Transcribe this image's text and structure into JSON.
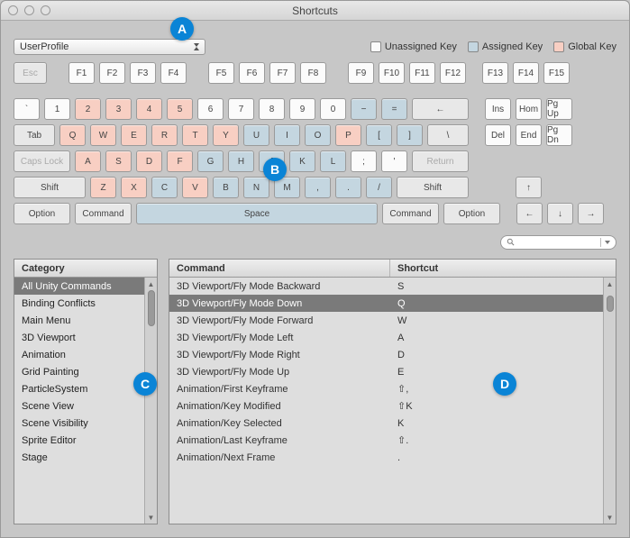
{
  "window": {
    "title": "Shortcuts"
  },
  "profile": {
    "selected": "UserProfile"
  },
  "legend": {
    "unassigned": "Unassigned Key",
    "assigned": "Assigned Key",
    "global": "Global Key"
  },
  "callouts": {
    "a": "A",
    "b": "B",
    "c": "C",
    "d": "D"
  },
  "keys": {
    "esc": "Esc",
    "f1": "F1",
    "f2": "F2",
    "f3": "F3",
    "f4": "F4",
    "f5": "F5",
    "f6": "F6",
    "f7": "F7",
    "f8": "F8",
    "f9": "F9",
    "f10": "F10",
    "f11": "F11",
    "f12": "F12",
    "f13": "F13",
    "f14": "F14",
    "f15": "F15",
    "backtick": "`",
    "k1": "1",
    "k2": "2",
    "k3": "3",
    "k4": "4",
    "k5": "5",
    "k6": "6",
    "k7": "7",
    "k8": "8",
    "k9": "9",
    "k0": "0",
    "minus": "−",
    "equals": "=",
    "back": "←",
    "ins": "Ins",
    "home": "Hom",
    "pgup": "Pg Up",
    "tab": "Tab",
    "q": "Q",
    "w": "W",
    "e": "E",
    "r": "R",
    "t": "T",
    "y": "Y",
    "u": "U",
    "i": "I",
    "o": "O",
    "p": "P",
    "lb": "[",
    "rb": "]",
    "bslash": "\\",
    "del": "Del",
    "end": "End",
    "pgdn": "Pg Dn",
    "caps": "Caps Lock",
    "a": "A",
    "s": "S",
    "d": "D",
    "f": "F",
    "g": "G",
    "h": "H",
    "j": "J",
    "k": "K",
    "l": "L",
    "semi": ";",
    "quote": "'",
    "return": "Return",
    "lshift": "Shift",
    "z": "Z",
    "x": "X",
    "c": "C",
    "v": "V",
    "b": "B",
    "n": "N",
    "m": "M",
    "comma": ",",
    "period": ".",
    "slash": "/",
    "rshift": "Shift",
    "up": "↑",
    "lopt": "Option",
    "lcmd": "Command",
    "space": "Space",
    "rcmd": "Command",
    "ropt": "Option",
    "left": "←",
    "down": "↓",
    "right": "→"
  },
  "tables": {
    "category_header": "Category",
    "command_header": "Command",
    "shortcut_header": "Shortcut",
    "categories": [
      "All Unity Commands",
      "Binding Conflicts",
      "Main Menu",
      "3D Viewport",
      "Animation",
      "Grid Painting",
      "ParticleSystem",
      "Scene View",
      "Scene Visibility",
      "Sprite Editor",
      "Stage"
    ],
    "category_selected": 0,
    "commands": [
      {
        "cmd": "3D Viewport/Fly Mode Backward",
        "sc": "S"
      },
      {
        "cmd": "3D Viewport/Fly Mode Down",
        "sc": "Q"
      },
      {
        "cmd": "3D Viewport/Fly Mode Forward",
        "sc": "W"
      },
      {
        "cmd": "3D Viewport/Fly Mode Left",
        "sc": "A"
      },
      {
        "cmd": "3D Viewport/Fly Mode Right",
        "sc": "D"
      },
      {
        "cmd": "3D Viewport/Fly Mode Up",
        "sc": "E"
      },
      {
        "cmd": "Animation/First Keyframe",
        "sc": "⇧,"
      },
      {
        "cmd": "Animation/Key Modified",
        "sc": "⇧K"
      },
      {
        "cmd": "Animation/Key Selected",
        "sc": "K"
      },
      {
        "cmd": "Animation/Last Keyframe",
        "sc": "⇧."
      },
      {
        "cmd": "Animation/Next Frame",
        "sc": "."
      }
    ],
    "command_selected": 1
  }
}
